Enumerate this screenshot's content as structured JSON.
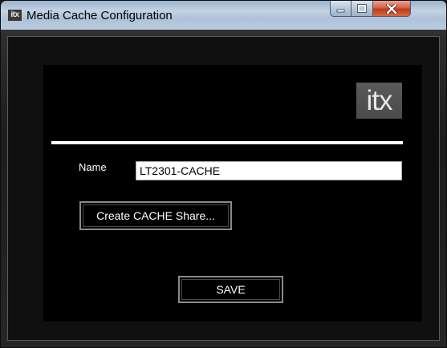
{
  "window": {
    "app_icon_text": "itx",
    "title": "Media Cache Configuration",
    "controls": {
      "minimize": "minimize-icon",
      "maximize": "maximize-icon",
      "close": "close-icon"
    }
  },
  "panel": {
    "logo_text": "itx",
    "name_label": "Name",
    "name_value": "LT2301-CACHE",
    "create_share_label": "Create CACHE Share...",
    "save_label": "SAVE"
  },
  "colors": {
    "panel_background": "#000000",
    "divider": "#ffffff",
    "close_button": "#c7462a"
  }
}
